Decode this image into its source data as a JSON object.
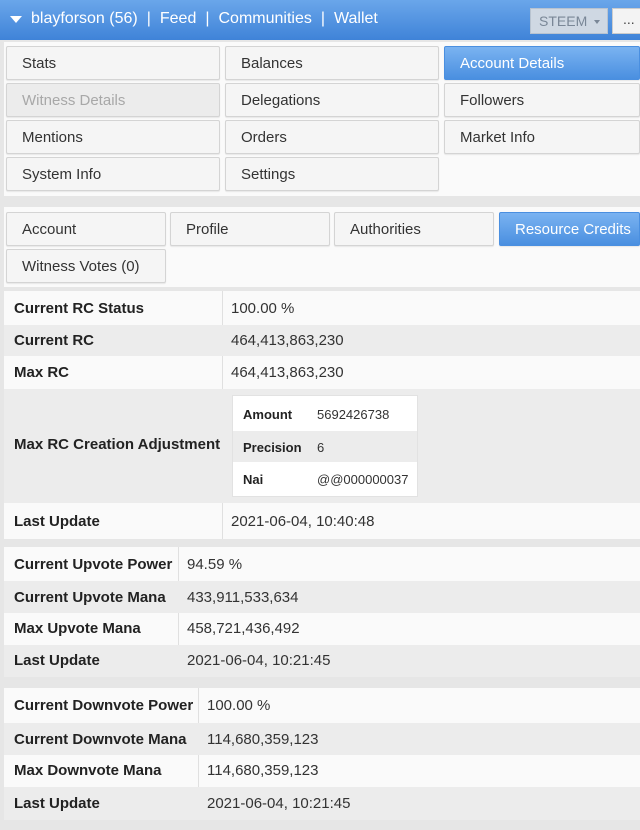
{
  "header": {
    "account": "blayforson (56)",
    "nav": [
      "Feed",
      "Communities",
      "Wallet"
    ],
    "separator": "|",
    "chain_select": "STEEM",
    "more": "..."
  },
  "main_menu": [
    [
      "Stats",
      "Balances",
      "Account Details"
    ],
    [
      "Witness Details",
      "Delegations",
      "Followers"
    ],
    [
      "Mentions",
      "Orders",
      "Market Info"
    ],
    [
      "System Info",
      "Settings"
    ]
  ],
  "sub_tabs": [
    "Account",
    "Profile",
    "Authorities",
    "Resource Credits",
    "Witness Votes (0)"
  ],
  "rc": {
    "status_label": "Current RC Status",
    "status_value": "100.00 %",
    "current_label": "Current RC",
    "current_value": "464,413,863,230",
    "max_label": "Max RC",
    "max_value": "464,413,863,230",
    "adj_label": "Max RC Creation Adjustment",
    "adj": {
      "amount_label": "Amount",
      "amount_value": "5692426738",
      "precision_label": "Precision",
      "precision_value": "6",
      "nai_label": "Nai",
      "nai_value": "@@000000037"
    },
    "update_label": "Last Update",
    "update_value": "2021-06-04, 10:40:48"
  },
  "upvote": {
    "power_label": "Current Upvote Power",
    "power_value": "94.59 %",
    "mana_label": "Current Upvote Mana",
    "mana_value": "433,911,533,634",
    "max_label": "Max Upvote Mana",
    "max_value": "458,721,436,492",
    "update_label": "Last Update",
    "update_value": "2021-06-04, 10:21:45"
  },
  "downvote": {
    "power_label": "Current Downvote Power",
    "power_value": "100.00 %",
    "mana_label": "Current Downvote Mana",
    "mana_value": "114,680,359,123",
    "max_label": "Max Downvote Mana",
    "max_value": "114,680,359,123",
    "update_label": "Last Update",
    "update_value": "2021-06-04, 10:21:45"
  }
}
